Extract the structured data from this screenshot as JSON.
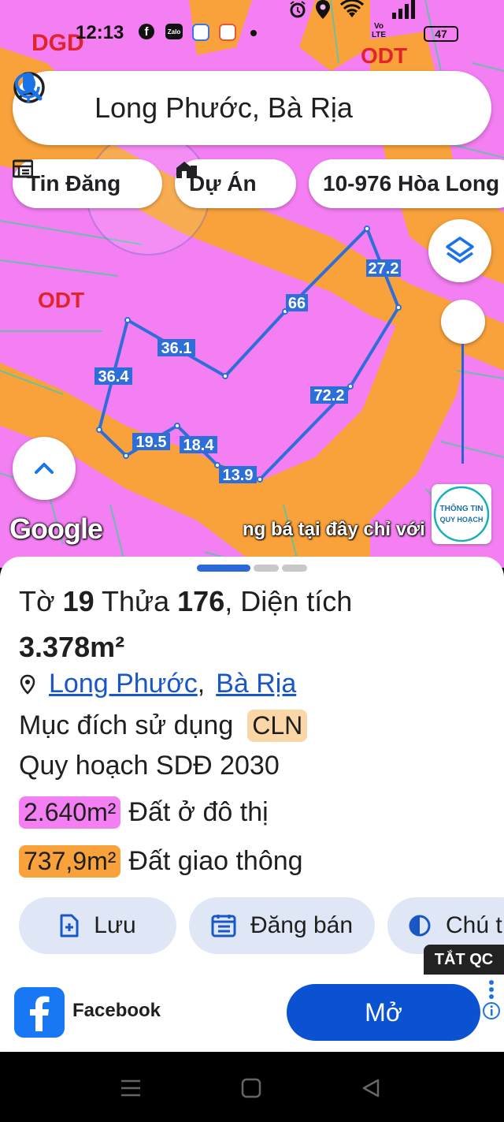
{
  "status_bar": {
    "time": "12:13",
    "battery": "47",
    "volte": "Vo LTE",
    "app_icons": [
      "facebook-icon",
      "zalo-icon",
      "app-icon",
      "game-icon"
    ],
    "system_icons": [
      "alarm-icon",
      "location-icon",
      "wifi-icon",
      "signal-icon",
      "battery-icon"
    ]
  },
  "search": {
    "query": "Long Phước, Bà Rịa"
  },
  "chips": [
    {
      "label": "Tin Đăng",
      "icon": "listing-icon"
    },
    {
      "label": "Dự Án",
      "icon": "project-icon"
    },
    {
      "label": "10-976 Hòa Long",
      "icon": ""
    }
  ],
  "map": {
    "zone_labels": [
      "DGD",
      "ODT",
      "ODT"
    ],
    "edge_lengths": [
      "27.2",
      "66",
      "36.1",
      "36.4",
      "72.2",
      "19.5",
      "18.4",
      "13.9"
    ],
    "google_logo": "Google",
    "marquee": "ng bá tại đây chỉ với",
    "info_badge_line1": "THÔNG TIN",
    "info_badge_line2": "QUY HOẠCH",
    "colors": {
      "residential": "#f47ff3",
      "road": "#f9a23b",
      "parcel_outline": "#2d6ed8"
    }
  },
  "sheet": {
    "title_to": "Tờ ",
    "sheet_no": "19",
    "title_thua": " Thửa ",
    "parcel_no": "176",
    "title_dt": ", Diện tích",
    "area": "3.378m²",
    "location_ward": "Long Phước",
    "location_sep": ",",
    "location_city": "Bà Rịa",
    "usage_label": "Mục đích sử dụng",
    "usage_code": "CLN",
    "plan_label": "Quy hoạch SDĐ 2030",
    "plan_items": [
      {
        "area": "2.640m²",
        "label": "Đất ở đô thị",
        "color": "#f47ff3"
      },
      {
        "area": "737,9m²",
        "label": "Đất giao thông",
        "color": "#f9a23b"
      }
    ],
    "actions": [
      {
        "label": "Lưu",
        "icon": "bookmark-add-icon"
      },
      {
        "label": "Đăng bán",
        "icon": "calendar-list-icon"
      },
      {
        "label": "Chú t",
        "icon": "contrast-icon"
      }
    ]
  },
  "ad": {
    "close_label": "TẮT QC",
    "app_name": "Facebook",
    "open_label": "Mở"
  }
}
